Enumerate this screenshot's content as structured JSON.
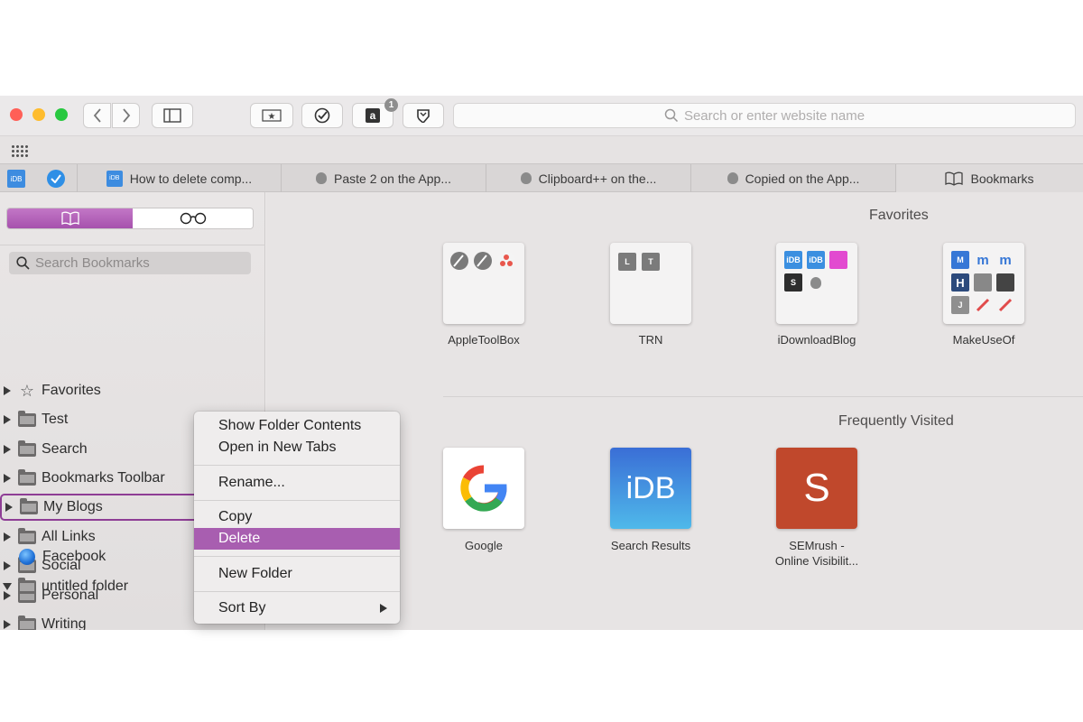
{
  "toolbar": {
    "url_placeholder": "Search or enter website name",
    "amazon_badge": "1"
  },
  "tabs": [
    {
      "label": "How to delete comp...",
      "icon": "idb-icon"
    },
    {
      "label": "Paste 2 on the App...",
      "icon": "apple-icon"
    },
    {
      "label": "Clipboard++ on the...",
      "icon": "apple-icon"
    },
    {
      "label": "Copied on the App...",
      "icon": "apple-icon"
    },
    {
      "label": "Bookmarks",
      "icon": "book-icon"
    }
  ],
  "sidebar": {
    "search_placeholder": "Search Bookmarks",
    "items": [
      {
        "label": "Favorites"
      },
      {
        "label": "Test"
      },
      {
        "label": "Search"
      },
      {
        "label": "Bookmarks Toolbar"
      },
      {
        "label": "My Blogs"
      },
      {
        "label": "All Links"
      },
      {
        "label": "Social"
      },
      {
        "label": "Personal"
      },
      {
        "label": "Writing"
      },
      {
        "label": "Facebook"
      },
      {
        "label": "untitled folder"
      }
    ]
  },
  "main": {
    "favorites_title": "Favorites",
    "frequent_title": "Frequently Visited",
    "favorites": [
      {
        "label": "AppleToolBox"
      },
      {
        "label": "TRN",
        "tiles": [
          "L",
          "T"
        ]
      },
      {
        "label": "iDownloadBlog",
        "tiles": [
          "iDB",
          "iDB",
          "S"
        ]
      },
      {
        "label": "MakeUseOf",
        "tiles": [
          "M",
          "m",
          "m",
          "H",
          "J"
        ]
      }
    ],
    "frequent": [
      {
        "label": "Google"
      },
      {
        "label": "Search Results",
        "tile_text": "iDB"
      },
      {
        "label_line1": "SEMrush -",
        "label_line2": "Online Visibilit...",
        "tile_text": "S"
      }
    ]
  },
  "context_menu": {
    "items": {
      "show_contents": "Show Folder Contents",
      "open_tabs": "Open in New Tabs",
      "rename": "Rename...",
      "copy": "Copy",
      "delete": "Delete",
      "new_folder": "New Folder",
      "sort_by": "Sort By"
    },
    "highlighted": "Delete",
    "highlight_color": "#a85eb0"
  },
  "colors": {
    "accent": "#a651ad",
    "close": "#ff5f57",
    "minimize": "#febc2e",
    "zoom": "#28c840"
  }
}
